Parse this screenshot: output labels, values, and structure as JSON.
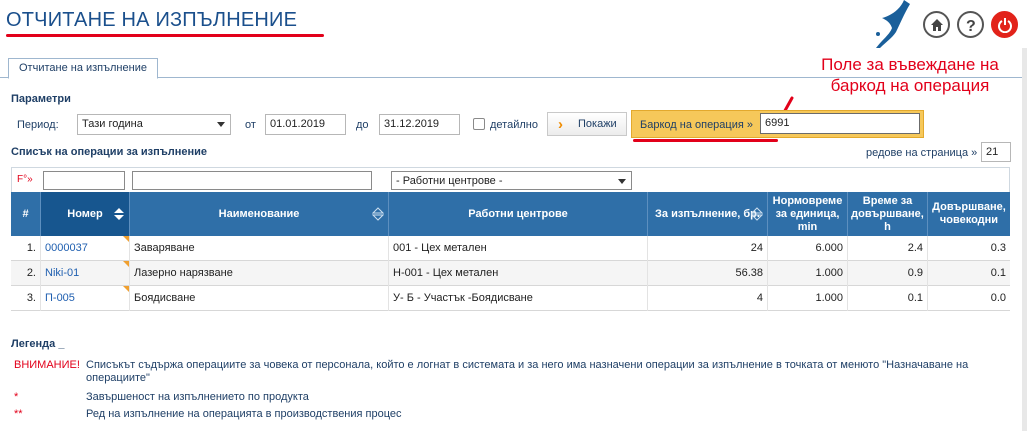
{
  "header": {
    "title": "ОТЧИТАНЕ НА ИЗПЪЛНЕНИЕ"
  },
  "tabs": [
    {
      "label": "Отчитане на изпълнение"
    }
  ],
  "annotation": {
    "line1": "Поле за въвеждане на",
    "line2": "баркод на операция"
  },
  "params": {
    "title": "Параметри",
    "period_label": "Период:",
    "period_value": "Тази година",
    "from_label": "от",
    "from_value": "01.01.2019",
    "to_label": "до",
    "to_value": "31.12.2019",
    "detailed_label": "детайлно",
    "show_button": "Покажи",
    "barcode_label": "Баркод на операция »",
    "barcode_value": "6991"
  },
  "list": {
    "title": "Списък на операции за изпълнение",
    "per_page_label": "редове на страница »",
    "per_page_value": "21",
    "filter_mark": "F°»",
    "workcenter_filter": "- Работни центрове -"
  },
  "table": {
    "headers": [
      "#",
      "Номер",
      "Наименование",
      "Работни центрове",
      "За изпълнение, бр.",
      "Нормовреме за единица, min",
      "Време за довършване, h",
      "Довършване, човекодни"
    ],
    "rows": [
      [
        "1.",
        "0000037",
        "Заваряване",
        "001 - Цех метален",
        "24",
        "6.000",
        "2.4",
        "0.3"
      ],
      [
        "2.",
        "Niki-01",
        "Лазерно нарязване",
        "Н-001 - Цех метален",
        "56.38",
        "1.000",
        "0.9",
        "0.1"
      ],
      [
        "3.",
        "П-005",
        "Боядисване",
        "У- Б - Участък -Боядисване",
        "4",
        "1.000",
        "0.1",
        "0.0"
      ]
    ]
  },
  "legend": {
    "title": "Легенда _",
    "items": [
      {
        "key": "ВНИМАНИЕ!",
        "text": "Списъкът съдържа операциите за човека от персонала, който е логнат в системата и за него има назначени операции за изпълнение в точката от менюто \"Назначаване на операциите\""
      },
      {
        "key": "*",
        "text": "Завършеност на изпълнението по продукта"
      },
      {
        "key": "**",
        "text": "Ред на изпълнение на операцията в производствения процес"
      }
    ]
  },
  "colors": {
    "brand_blue": "#2f6fa8",
    "accent_red": "#e2001a",
    "barcode_bg": "#f6c85a"
  }
}
